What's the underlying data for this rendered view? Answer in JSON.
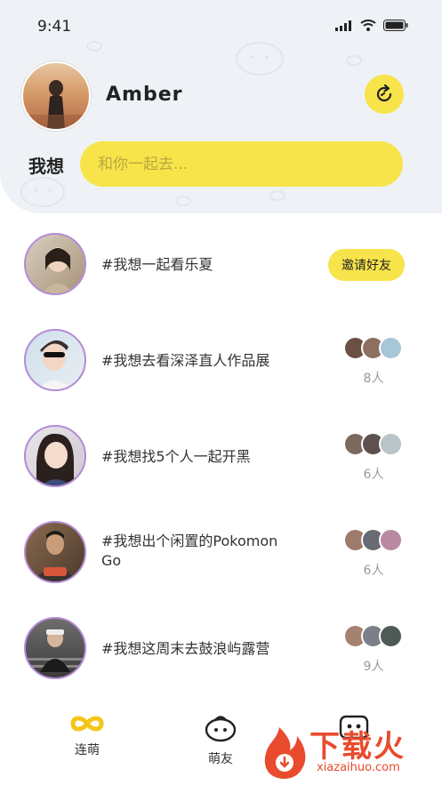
{
  "status": {
    "time": "9:41"
  },
  "profile": {
    "name": "Amber"
  },
  "wish": {
    "label": "我想",
    "placeholder": "和你一起去..."
  },
  "items": [
    {
      "text": "#我想一起看乐夏",
      "action_label": "邀请好友"
    },
    {
      "text": "#我想去看深泽直人作品展",
      "count": "8人"
    },
    {
      "text": "#我想找5个人一起开黑",
      "count": "6人"
    },
    {
      "text": "#我想出个闲置的Pokomon Go",
      "count": "6人"
    },
    {
      "text": "#我想这周末去鼓浪屿露营",
      "count": "9人"
    }
  ],
  "tabs": [
    {
      "label": "连萌",
      "icon": "infinity-icon"
    },
    {
      "label": "萌友",
      "icon": "face-icon"
    },
    {
      "label": "",
      "icon": "chat-icon"
    }
  ],
  "watermark": {
    "text": "下载火",
    "url": "xiazaihuo.com",
    "logo": "flame-logo"
  },
  "colors": {
    "accent": "#f7e44a",
    "header_bg": "#eef2f6",
    "avatar_ring": "#b48bd6",
    "watermark": "#e94b2e"
  }
}
